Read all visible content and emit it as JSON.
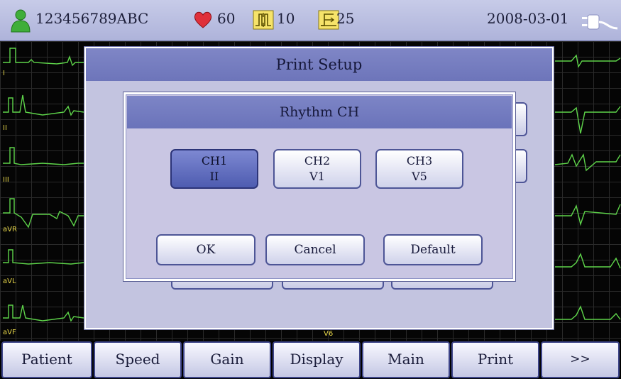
{
  "status_bar": {
    "patient_id": "123456789ABC",
    "heart_rate": "60",
    "lead_value_1": "10",
    "lead_value_2": "25",
    "date": "2008-03-01"
  },
  "ecg": {
    "lead_labels": [
      "I",
      "II",
      "III",
      "aVR",
      "aVL",
      "aVF"
    ],
    "right_label": "V6",
    "trace_color": "#5ed44a",
    "label_color": "#e8d84a"
  },
  "print_setup": {
    "title": "Print Setup"
  },
  "rhythm_dialog": {
    "title": "Rhythm CH",
    "channels": [
      {
        "name": "CH1",
        "lead": "II",
        "selected": true
      },
      {
        "name": "CH2",
        "lead": "V1",
        "selected": false
      },
      {
        "name": "CH3",
        "lead": "V5",
        "selected": false
      }
    ],
    "ok_label": "OK",
    "cancel_label": "Cancel",
    "default_label": "Default"
  },
  "menu": {
    "items": [
      "Patient",
      "Speed",
      "Gain",
      "Display",
      "Main",
      "Print",
      ">>"
    ]
  },
  "colors": {
    "accent": "#6d75ba",
    "selected_button": "#4e5cb0",
    "heart": "#e0303a",
    "patient_icon": "#3fae3a"
  }
}
